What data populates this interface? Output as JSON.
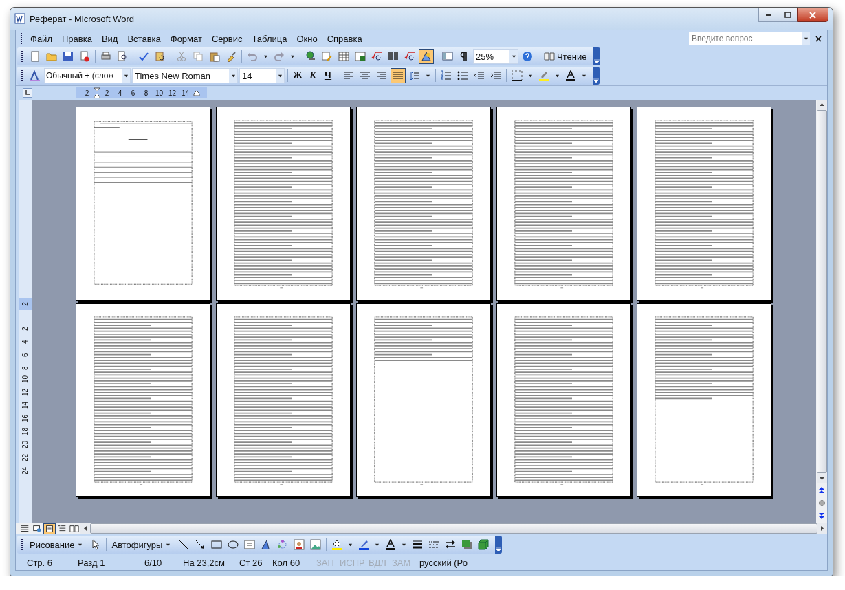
{
  "window": {
    "title": "Реферат - Microsoft Word"
  },
  "menu": [
    {
      "label": "Файл"
    },
    {
      "label": "Правка"
    },
    {
      "label": "Вид"
    },
    {
      "label": "Вставка"
    },
    {
      "label": "Формат"
    },
    {
      "label": "Сервис"
    },
    {
      "label": "Таблица"
    },
    {
      "label": "Окно"
    },
    {
      "label": "Справка"
    }
  ],
  "help_box": {
    "placeholder": "Введите вопрос"
  },
  "standard_toolbar": {
    "drawing_toggle_selected": true,
    "zoom": "25%",
    "reading_button": "Чтение"
  },
  "formatting_toolbar": {
    "style": "Обычный + (слож",
    "font": "Times New Roman",
    "size": "14",
    "bold": "Ж",
    "italic": "К",
    "underline": "Ч",
    "alignment": [
      {
        "selected": false
      },
      {
        "selected": false
      },
      {
        "selected": false
      },
      {
        "selected": true
      }
    ]
  },
  "ruler": {
    "marks": [
      "2",
      "2",
      "4",
      "6",
      "8",
      "10",
      "12",
      "14"
    ]
  },
  "vertical_ruler": {
    "top_mark": "2",
    "marks": [
      "2",
      "4",
      "6",
      "8",
      "10",
      "12",
      "14",
      "16",
      "18",
      "20",
      "22",
      "24"
    ]
  },
  "pages": [
    {
      "kind": "toc"
    },
    {
      "kind": "full"
    },
    {
      "kind": "full"
    },
    {
      "kind": "full"
    },
    {
      "kind": "full"
    },
    {
      "kind": "full"
    },
    {
      "kind": "full"
    },
    {
      "kind": "short"
    },
    {
      "kind": "full"
    },
    {
      "kind": "references"
    }
  ],
  "view_buttons": [
    {
      "selected": false
    },
    {
      "selected": false
    },
    {
      "selected": true
    },
    {
      "selected": false
    },
    {
      "selected": false
    }
  ],
  "drawing_toolbar": {
    "draw_menu": "Рисование",
    "autoshapes": "Автофигуры"
  },
  "status_bar": [
    {
      "text": "Стр. 6",
      "disabled": false
    },
    {
      "text": "Разд 1",
      "disabled": false
    },
    {
      "text": "6/10",
      "disabled": false
    },
    {
      "text": "На 23,2см",
      "disabled": false
    },
    {
      "text": "Ст 26",
      "disabled": false
    },
    {
      "text": "Кол 60",
      "disabled": false
    },
    {
      "text": "ЗАП",
      "disabled": true
    },
    {
      "text": "ИСПР",
      "disabled": true
    },
    {
      "text": "ВДЛ",
      "disabled": true
    },
    {
      "text": "ЗАМ",
      "disabled": true
    },
    {
      "text": "русский (Ро",
      "disabled": false
    }
  ]
}
